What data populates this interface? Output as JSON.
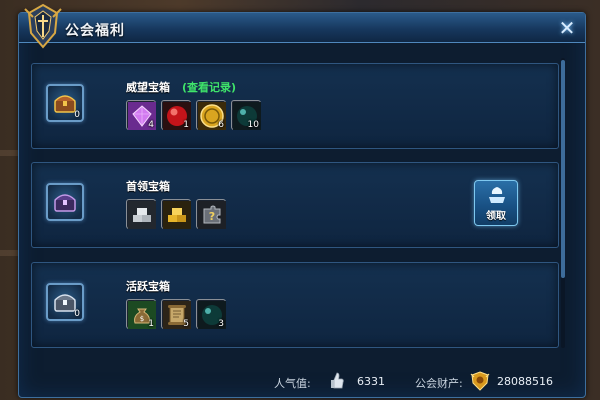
{
  "window": {
    "title": "公会福利",
    "close_icon": "close-icon"
  },
  "sections": [
    {
      "title": "威望宝箱",
      "link": "(查看记录)",
      "chest_count": "0",
      "chest_icon": "gold-chest-icon",
      "items": [
        {
          "icon": "purple-gem-icon",
          "count": "4"
        },
        {
          "icon": "red-orb-icon",
          "count": "1"
        },
        {
          "icon": "gold-coin-icon",
          "count": "6"
        },
        {
          "icon": "dark-teal-orb-icon",
          "count": "10"
        }
      ]
    },
    {
      "title": "首领宝箱",
      "chest_count": "",
      "chest_icon": "purple-chest-icon",
      "items": [
        {
          "icon": "silver-ingots-icon",
          "count": ""
        },
        {
          "icon": "gold-ingots-icon",
          "count": ""
        },
        {
          "icon": "mystery-puzzle-icon",
          "count": ""
        }
      ],
      "claim_label": "领取",
      "claim_icon": "claim-hand-icon"
    },
    {
      "title": "活跃宝箱",
      "chest_count": "0",
      "chest_icon": "silver-chest-icon",
      "items": [
        {
          "icon": "money-bag-icon",
          "count": "1"
        },
        {
          "icon": "scroll-icon",
          "count": "5"
        },
        {
          "icon": "dark-teal-orb-icon",
          "count": "3"
        }
      ]
    }
  ],
  "footer": {
    "popularity_label": "人气值:",
    "popularity_value": "6331",
    "popularity_icon": "thumbs-up-icon",
    "wealth_label": "公会财产:",
    "wealth_value": "28088516",
    "wealth_icon": "guild-shield-icon"
  },
  "colors": {
    "panel_bg": "#0d1d30",
    "section_bg": "#14304f",
    "link_green": "#3fe36a",
    "border_blue": "#3e6f9e"
  }
}
